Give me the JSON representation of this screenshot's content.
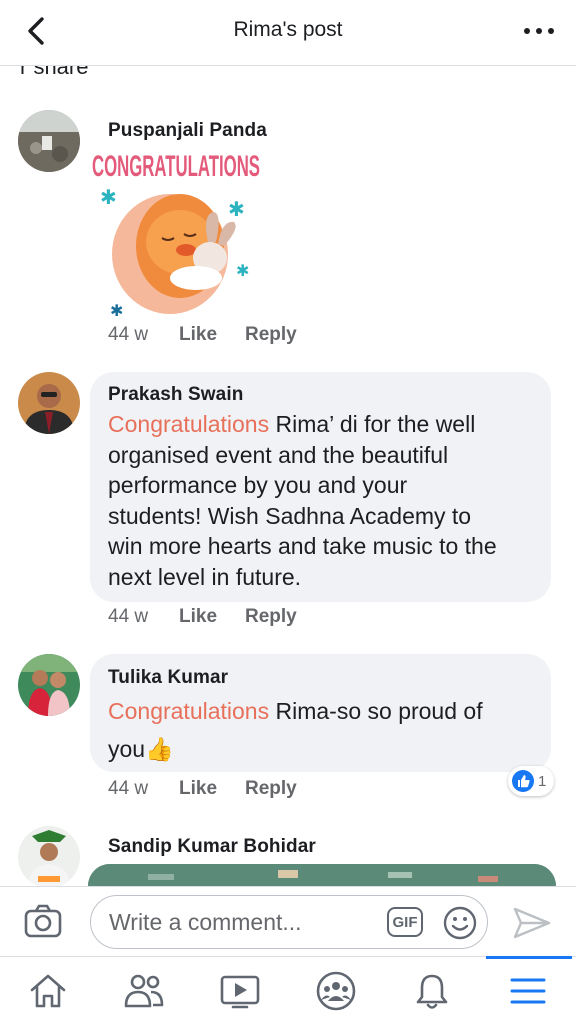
{
  "header": {
    "title": "Rima's post"
  },
  "cut_text": "r share",
  "comments": [
    {
      "author": "Puspanjali Panda",
      "sticker_text": "CONGRATULATIONS",
      "time": "44 w",
      "like_label": "Like",
      "reply_label": "Reply"
    },
    {
      "author": "Prakash Swain",
      "highlight": "Congratulations",
      "lines": [
        " Rima’ di for the well",
        "organised event and the beautiful",
        "performance by you and your",
        "students! Wish Sadhna Academy to",
        "win more hearts and take music to the",
        "next level in future."
      ],
      "time": "44 w",
      "like_label": "Like",
      "reply_label": "Reply"
    },
    {
      "author": "Tulika Kumar",
      "highlight": "Congratulations",
      "lines": [
        " Rima-so so proud of",
        "you👍"
      ],
      "time": "44 w",
      "like_label": "Like",
      "reply_label": "Reply",
      "reaction_count": "1"
    },
    {
      "author": "Sandip Kumar Bohidar"
    }
  ],
  "composer": {
    "placeholder": "Write a comment...",
    "gif_label": "GIF"
  },
  "tabs": [
    "home-icon",
    "friends-icon",
    "watch-icon",
    "groups-icon",
    "notifications-icon",
    "menu-icon"
  ],
  "colors": {
    "highlight": "#e8705a",
    "accent": "#1877f2",
    "bubble": "#f0f2f5"
  }
}
